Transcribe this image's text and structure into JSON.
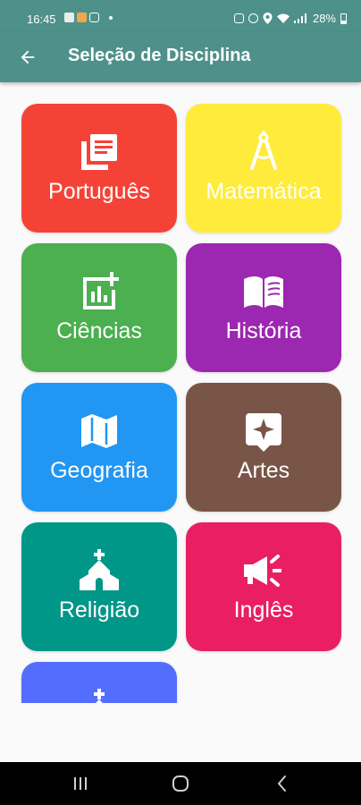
{
  "status_bar": {
    "time": "16:45",
    "battery_percent": "28%"
  },
  "app_bar": {
    "title": "Seleção de Disciplina",
    "back_icon": "arrow-back-icon"
  },
  "subjects": [
    {
      "label": "Português",
      "icon": "article-icon",
      "color": "#f44336"
    },
    {
      "label": "Matemática",
      "icon": "compass-icon",
      "color": "#ffeb3b"
    },
    {
      "label": "Ciências",
      "icon": "chart-add-icon",
      "color": "#4caf50"
    },
    {
      "label": "História",
      "icon": "open-book-icon",
      "color": "#9c27b0"
    },
    {
      "label": "Geografia",
      "icon": "map-icon",
      "color": "#2196f3"
    },
    {
      "label": "Artes",
      "icon": "sparkle-pin-icon",
      "color": "#795548"
    },
    {
      "label": "Religião",
      "icon": "church-icon",
      "color": "#009688"
    },
    {
      "label": "Inglês",
      "icon": "megaphone-icon",
      "color": "#e91e63"
    },
    {
      "label": "",
      "icon": "church-icon",
      "color": "#536dfe"
    }
  ],
  "nav_bar": {
    "recents_icon": "recents-icon",
    "home_icon": "home-icon",
    "back_icon": "nav-back-icon"
  }
}
